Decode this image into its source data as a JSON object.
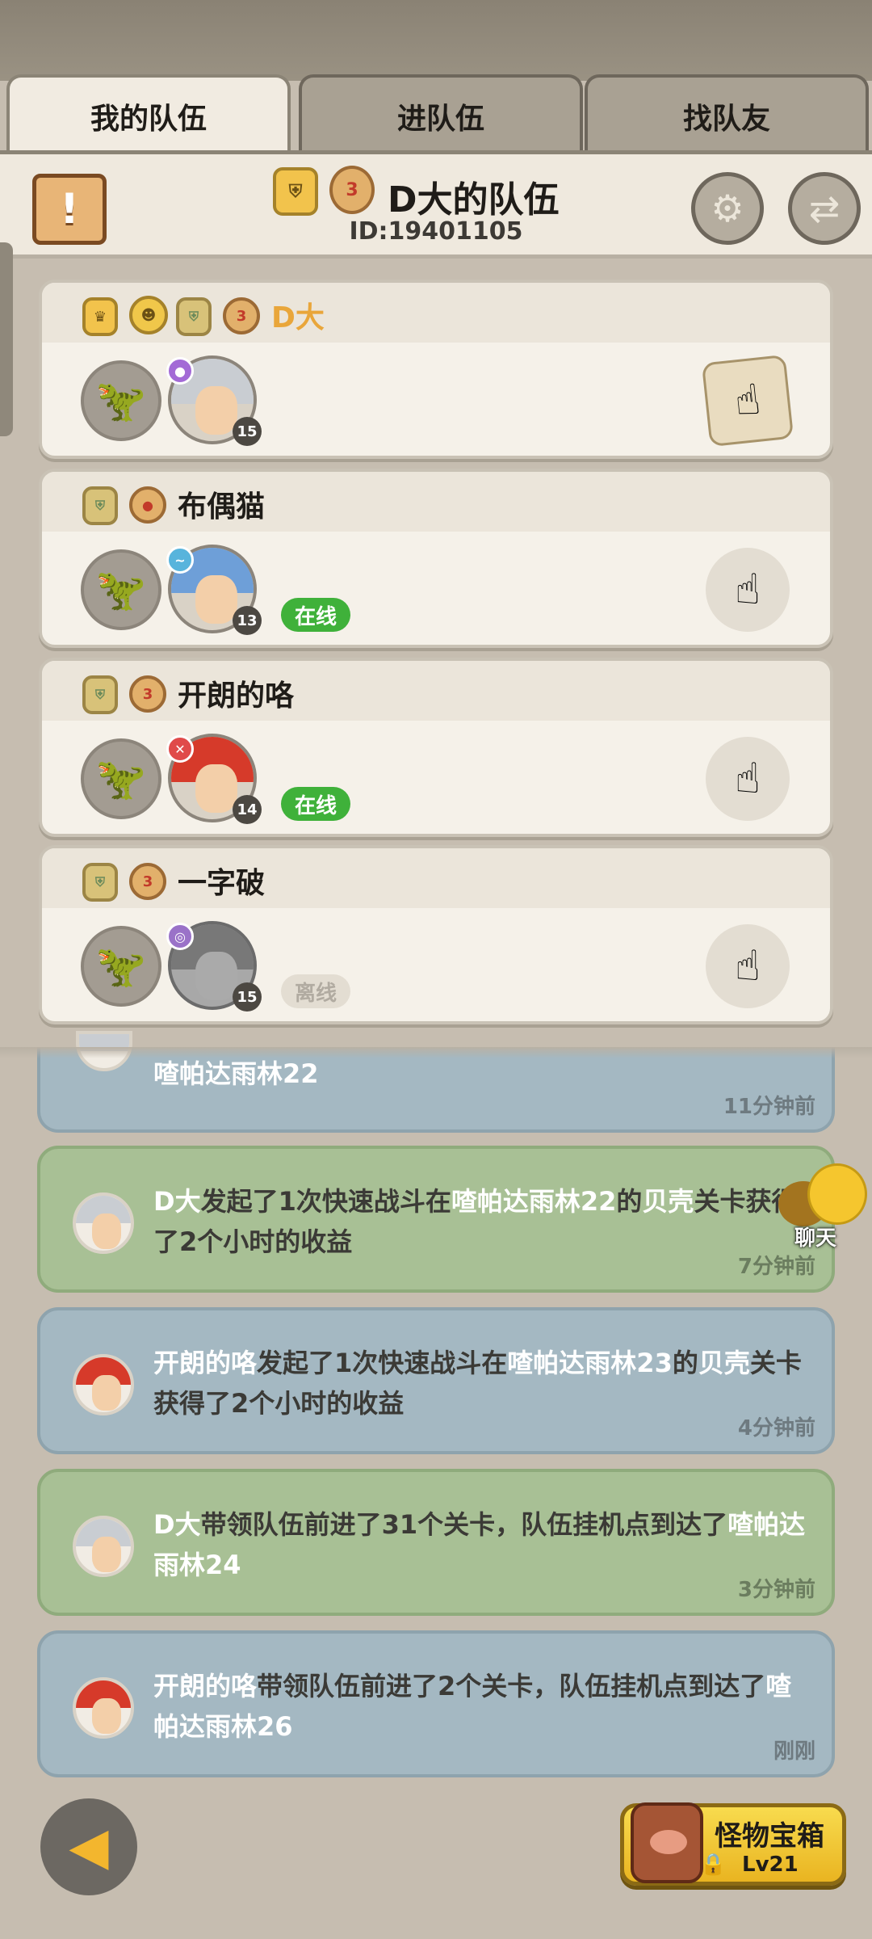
{
  "tabs": [
    "我的队伍",
    "进队伍",
    "找队友"
  ],
  "team": {
    "name": "D大的队伍",
    "id": "ID:19401105"
  },
  "members": [
    {
      "name": "D大",
      "level": "15",
      "status": ""
    },
    {
      "name": "布偶猫",
      "level": "13",
      "status": "在线"
    },
    {
      "name": "开朗的咯",
      "level": "14",
      "status": "在线"
    },
    {
      "name": "一字破",
      "level": "15",
      "status": "离线"
    }
  ],
  "logs": {
    "partial": {
      "text": "喳帕达雨林22",
      "time": "11分钟前"
    },
    "entries": [
      {
        "actor": "D大",
        "text1": "发起了1次快速战斗在",
        "place": "喳帕达雨林22",
        "text2": "的",
        "stage": "贝壳",
        "text3": "关卡获得了2个小时的收益",
        "time": "7分钟前"
      },
      {
        "actor": "开朗的咯",
        "text1": "发起了1次快速战斗在",
        "place": "喳帕达雨林23",
        "text2": "的",
        "stage": "贝壳",
        "text3": "关卡获得了2个小时的收益",
        "time": "4分钟前"
      },
      {
        "actor": "D大",
        "text1": "带领队伍前进了31个关卡，队伍挂机点到达了",
        "place": "喳帕达雨林24",
        "time": "3分钟前"
      },
      {
        "actor": "开朗的咯",
        "text1": "带领队伍前进了2个关卡，队伍挂机点到达了",
        "place": "喳帕达雨林26",
        "time": "刚刚"
      }
    ]
  },
  "chat": {
    "label": "聊天"
  },
  "chest": {
    "title": "怪物宝箱",
    "level": "Lv21"
  },
  "icons": {
    "warn": "exclamation-scroll-icon",
    "settings": "gear-icon",
    "switch": "switch-team-icon",
    "back": "back-arrow-icon",
    "lock": "lock-icon"
  },
  "colors": {
    "online": "#3fb13a",
    "leader_name": "#e9a63a",
    "log_blue": "#a4b8c2",
    "log_green": "#a8c095"
  }
}
